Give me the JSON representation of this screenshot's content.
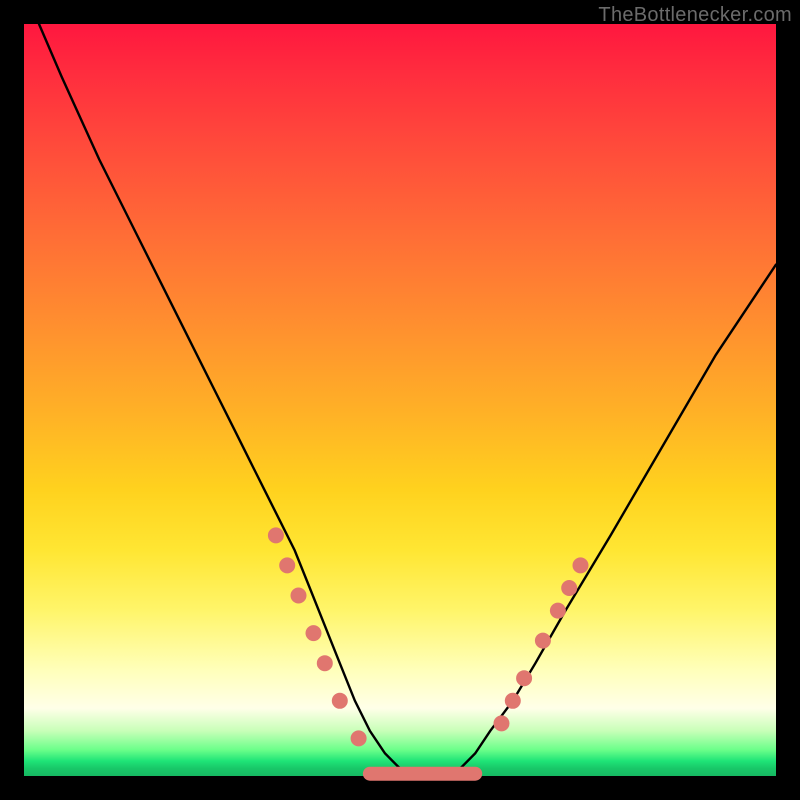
{
  "watermark": "TheBottleneсker.com",
  "colors": {
    "background": "#000000",
    "gradient_top": "#ff173f",
    "gradient_mid": "#ffd21e",
    "gradient_bottom": "#16b862",
    "curve": "#000000",
    "marker": "#e0766f"
  },
  "chart_data": {
    "type": "line",
    "title": "",
    "xlabel": "",
    "ylabel": "",
    "xlim": [
      0,
      100
    ],
    "ylim": [
      0,
      100
    ],
    "series": [
      {
        "name": "curve",
        "x": [
          2,
          5,
          10,
          15,
          20,
          25,
          28,
          30,
          32,
          34,
          36,
          38,
          40,
          42,
          44,
          46,
          48,
          50,
          52,
          54,
          56,
          58,
          60,
          62,
          65,
          68,
          72,
          78,
          85,
          92,
          100
        ],
        "y": [
          100,
          93,
          82,
          72,
          62,
          52,
          46,
          42,
          38,
          34,
          30,
          25,
          20,
          15,
          10,
          6,
          3,
          1,
          0,
          0,
          0,
          1,
          3,
          6,
          10,
          15,
          22,
          32,
          44,
          56,
          68
        ]
      }
    ],
    "markers_left": [
      {
        "x": 33.5,
        "y": 32
      },
      {
        "x": 35.0,
        "y": 28
      },
      {
        "x": 36.5,
        "y": 24
      },
      {
        "x": 38.5,
        "y": 19
      },
      {
        "x": 40.0,
        "y": 15
      },
      {
        "x": 42.0,
        "y": 10
      },
      {
        "x": 44.5,
        "y": 5
      }
    ],
    "markers_right": [
      {
        "x": 63.5,
        "y": 7
      },
      {
        "x": 65.0,
        "y": 10
      },
      {
        "x": 66.5,
        "y": 13
      },
      {
        "x": 69.0,
        "y": 18
      },
      {
        "x": 71.0,
        "y": 22
      },
      {
        "x": 72.5,
        "y": 25
      },
      {
        "x": 74.0,
        "y": 28
      }
    ],
    "flat_segment": {
      "x0": 46,
      "x1": 60,
      "y": 0.3
    }
  }
}
